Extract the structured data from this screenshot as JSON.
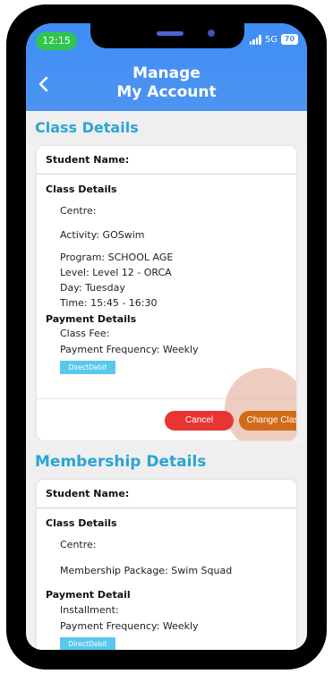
{
  "status_bar": {
    "time": "12:15",
    "network": "5G",
    "battery": "70"
  },
  "header": {
    "title": "Manage\nMy Account",
    "back_icon": "chevron-left-icon"
  },
  "class_section": {
    "title": "Class Details",
    "student_label": "Student Name:",
    "class_details_title": "Class Details",
    "centre": "Centre:",
    "activity": "Activity: GOSwim",
    "program": "Program: SCHOOL AGE",
    "level": "Level: Level 12 - ORCA",
    "day": "Day: Tuesday",
    "time": "Time: 15:45 - 16:30",
    "payment_title": "Payment Details",
    "class_fee": "Class Fee:",
    "payment_frequency": "Payment Frequency: Weekly",
    "payment_method": "DirectDebit",
    "cancel_label": "Cancel",
    "change_class_label": "Change Class"
  },
  "membership_section": {
    "title": "Membership Details",
    "student_label": "Student Name:",
    "class_details_title": "Class Details",
    "centre": "Centre:",
    "package": "Membership Package: Swim Squad",
    "payment_title": "Payment Detail",
    "installment": "Installment:",
    "payment_frequency": "Payment Frequency: Weekly",
    "payment_method": "DirectDebit"
  },
  "colors": {
    "header": "#3f8ef6",
    "section_title": "#2aa4d8",
    "cancel": "#e93434",
    "change_class": "#d16b1a",
    "badge": "#58c8ee"
  }
}
